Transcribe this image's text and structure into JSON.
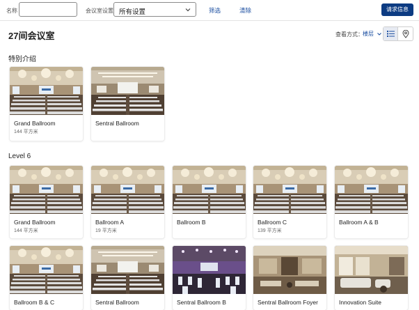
{
  "filters": {
    "name_label": "名称",
    "name_value": "",
    "setting_label": "会议室设置",
    "setting_value": "所有设置",
    "filter_link": "筛选",
    "clear_link": "清除",
    "request_button": "请求信息"
  },
  "header": {
    "title": "27间会议室",
    "view_label": "查看方式：",
    "view_select": "楼层",
    "icons": [
      "list-icon",
      "map-pin-icon"
    ]
  },
  "featured": {
    "title": "特别介绍",
    "rooms": [
      {
        "name": "Grand Ballroom",
        "area": "144 平方米"
      },
      {
        "name": "Sentral Ballroom",
        "area": ""
      }
    ]
  },
  "level6": {
    "title": "Level 6",
    "rooms": [
      {
        "name": "Grand Ballroom",
        "area": "144 平方米"
      },
      {
        "name": "Ballroom A",
        "area": "19 平方米"
      },
      {
        "name": "Ballroom B",
        "area": ""
      },
      {
        "name": "Ballroom C",
        "area": "139 平方米"
      },
      {
        "name": "Ballroom A & B",
        "area": ""
      },
      {
        "name": "Ballroom B & C",
        "area": ""
      },
      {
        "name": "Sentral Ballroom",
        "area": ""
      },
      {
        "name": "Sentral Ballroom B",
        "area": ""
      },
      {
        "name": "Sentral Ballroom Foyer",
        "area": ""
      },
      {
        "name": "Innovation Suite",
        "area": ""
      }
    ]
  },
  "colors": {
    "accent": "#0c3b82",
    "link": "#1c4fa1"
  }
}
